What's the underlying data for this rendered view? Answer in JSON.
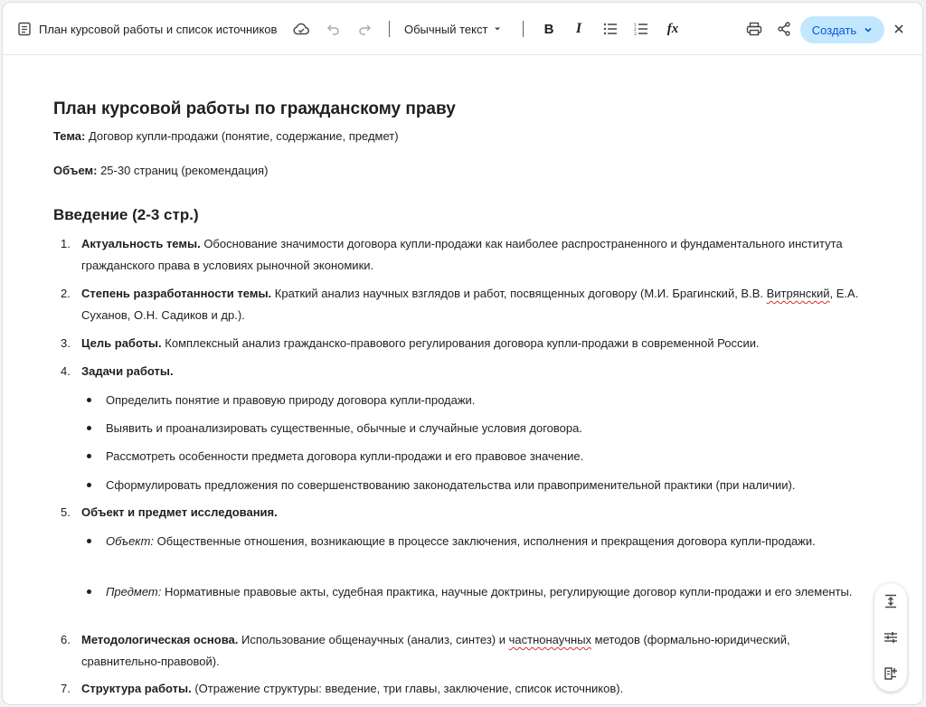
{
  "toolbar": {
    "doc_title": "План курсовой работы и список источников",
    "style_select": "Обычный текст",
    "bold": "B",
    "italic": "I",
    "formula": "fx",
    "create_label": "Создать"
  },
  "doc": {
    "title": "План курсовой работы по гражданскому праву",
    "topic_label": "Тема:",
    "topic_value": " Договор купли-продажи (понятие, содержание, предмет)",
    "volume_label": "Объем:",
    "volume_value": " 25-30 страниц (рекомендация)",
    "intro_heading": "Введение (2-3 стр.)",
    "items": [
      {
        "num": "1.",
        "bold": "Актуальность темы.",
        "text": " Обоснование значимости договора купли-продажи как наиболее распространенного и фундаментального института гражданского права в условиях рыночной экономики."
      },
      {
        "num": "2.",
        "bold": "Степень разработанности темы.",
        "text_a": " Краткий анализ научных взглядов и работ, посвященных договору (М.И. Брагинский, В.В. ",
        "spell": "Витрянский",
        "text_b": ", Е.А. Суханов, О.Н. Садиков и др.)."
      },
      {
        "num": "3.",
        "bold": "Цель работы.",
        "text": " Комплексный анализ гражданско-правового регулирования договора купли-продажи в современной России."
      },
      {
        "num": "4.",
        "bold": "Задачи работы."
      },
      {
        "num": "5.",
        "bold": "Объект и предмет исследования."
      },
      {
        "num": "6.",
        "bold": "Методологическая основа.",
        "text_a": " Использование общенаучных (анализ, синтез) и ",
        "spell": "частнонаучных",
        "text_b": " методов (формально-юридический, сравнительно-правовой)."
      },
      {
        "num": "7.",
        "bold": "Структура работы.",
        "text": " (Отражение структуры: введение, три главы, заключение, список источников)."
      }
    ],
    "tasks": [
      "Определить понятие и правовую природу договора купли-продажи.",
      "Выявить и проанализировать существенные, обычные и случайные условия договора.",
      "Рассмотреть особенности предмета договора купли-продажи и его правовое значение.",
      "Сформулировать предложения по совершенствованию законодательства или правоприменительной практики (при наличии)."
    ],
    "object_label": "Объект:",
    "object_text": " Общественные отношения, возникающие в процессе заключения, исполнения и прекращения договора купли-продажи.",
    "subject_label": "Предмет:",
    "subject_text": " Нормативные правовые акты, судебная практика, научные доктрины, регулирующие договор купли-продажи и его элементы."
  },
  "icons": {
    "doc": "document-icon",
    "cloud": "cloud-save-icon",
    "undo": "undo-icon",
    "redo": "redo-icon",
    "dropdown": "chevron-down-icon",
    "bullets": "bulleted-list-icon",
    "numbers": "numbered-list-icon",
    "print": "print-icon",
    "share": "share-icon",
    "close": "close-icon",
    "align": "vertical-align-icon",
    "tune": "tune-icon",
    "add_note": "add-note-icon"
  },
  "colors": {
    "accent_bg": "#c2e7ff",
    "accent_text": "#0b57d0",
    "spellcheck": "#d93025"
  }
}
